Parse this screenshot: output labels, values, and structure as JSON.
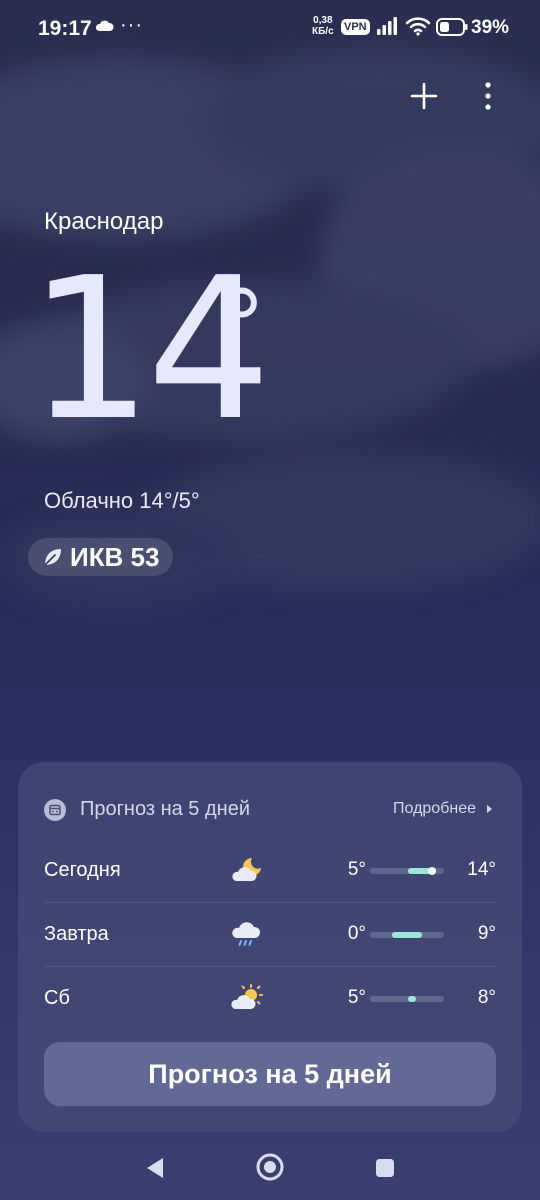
{
  "status_bar": {
    "time": "19:17",
    "dots": "···",
    "speed_value": "0,38",
    "speed_unit": "КБ/с",
    "vpn": "VPN",
    "battery_pct": "39%"
  },
  "location": {
    "city": "Краснодар"
  },
  "current": {
    "temp": "14",
    "deg": "°",
    "condition": "Облачно  14°/5°"
  },
  "aqi": {
    "label": "ИКВ 53"
  },
  "forecast": {
    "title": "Прогноз на 5 дней",
    "more": "Подробнее",
    "days": [
      {
        "day": "Сегодня",
        "icon": "cloudy-night-icon",
        "low": "5°",
        "high": "14°"
      },
      {
        "day": "Завтра",
        "icon": "rain-icon",
        "low": "0°",
        "high": "9°"
      },
      {
        "day": "Сб",
        "icon": "partly-sunny-icon",
        "low": "5°",
        "high": "8°"
      }
    ],
    "button": "Прогноз на 5 дней"
  },
  "colors": {
    "accent_bar": "#9be8d8",
    "background": "#262b4f"
  }
}
